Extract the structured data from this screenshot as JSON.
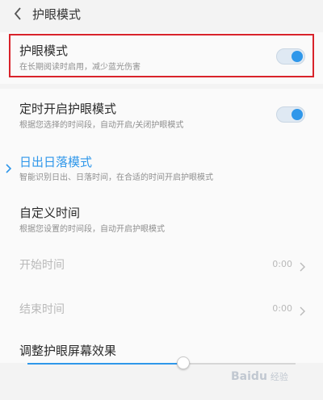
{
  "header": {
    "title": "护眼模式"
  },
  "eye_mode": {
    "title": "护眼模式",
    "subtitle": "在长期阅读时启用，减少蓝光伤害",
    "enabled": true
  },
  "schedule": {
    "title": "定时开启护眼模式",
    "subtitle": "根据您选择的时间段，自动开启/关闭护眼模式",
    "enabled": true
  },
  "sunrise": {
    "title": "日出日落模式",
    "subtitle": "智能识别日出、日落时间，在合适的时间开启护眼模式"
  },
  "custom": {
    "title": "自定义时间",
    "subtitle": "根据您设置的时间段，自动开启护眼模式"
  },
  "start_time": {
    "label": "开始时间",
    "value": "0:00"
  },
  "end_time": {
    "label": "结束时间",
    "value": "0:00"
  },
  "effect": {
    "title": "调整护眼屏幕效果",
    "level": 0.58
  },
  "watermark": {
    "text": "Baidu",
    "suffix": "经验"
  },
  "colors": {
    "accent": "#2f97ea",
    "highlight_border": "#d9232b"
  }
}
